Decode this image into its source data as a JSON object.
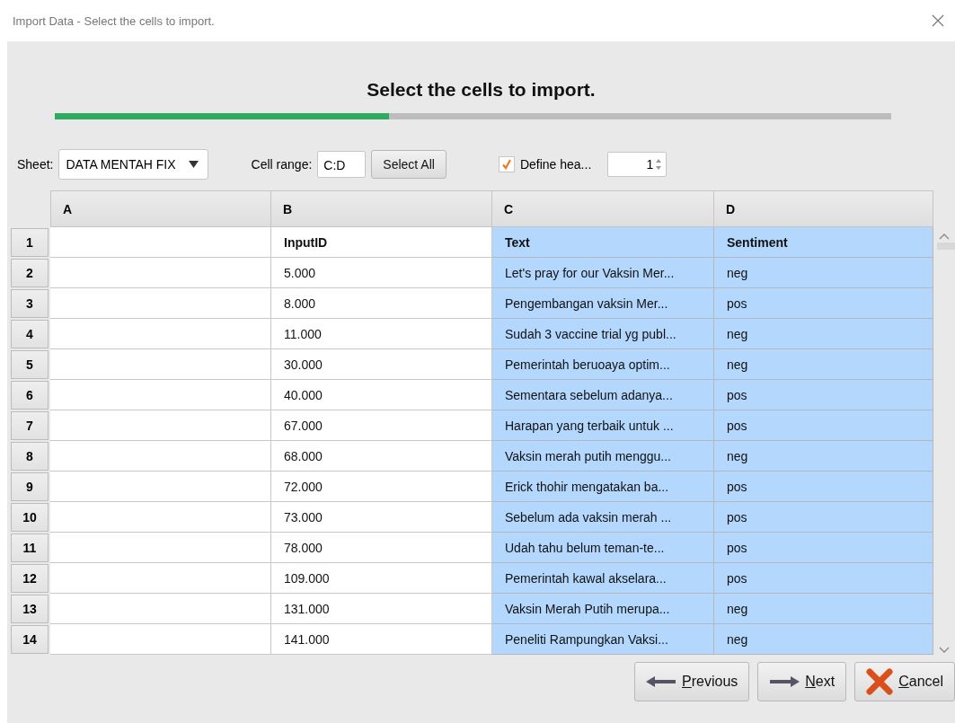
{
  "window": {
    "title": "Import Data - Select the cells to import."
  },
  "heading": "Select the cells to import.",
  "progress": {
    "level": 0.4
  },
  "toolbar": {
    "sheet_label": "Sheet:",
    "sheet_value": "DATA MENTAH FIX",
    "range_label": "Cell range:",
    "range_value": "C:D",
    "select_all": "Select All",
    "define_header": {
      "label": "Define hea...",
      "checked": true
    },
    "header_row": "1"
  },
  "table": {
    "columns": [
      {
        "label": "A",
        "selected": false
      },
      {
        "label": "B",
        "selected": false
      },
      {
        "label": "C",
        "selected": true
      },
      {
        "label": "D",
        "selected": true
      }
    ],
    "rows": [
      {
        "number": "1",
        "kind": "header",
        "cells": [
          "",
          "InputID",
          "Text",
          "Sentiment"
        ]
      },
      {
        "number": "2",
        "kind": "data",
        "cells": [
          "",
          "5.000",
          "Let's pray for our Vaksin Mer...",
          "neg"
        ]
      },
      {
        "number": "3",
        "kind": "data",
        "cells": [
          "",
          "8.000",
          "Pengembangan vaksin Mer...",
          "pos"
        ]
      },
      {
        "number": "4",
        "kind": "data",
        "cells": [
          "",
          "11.000",
          "Sudah 3 vaccine trial yg publ...",
          "neg"
        ]
      },
      {
        "number": "5",
        "kind": "data",
        "cells": [
          "",
          "30.000",
          "Pemerintah beruoaya optim...",
          "neg"
        ]
      },
      {
        "number": "6",
        "kind": "data",
        "cells": [
          "",
          "40.000",
          "Sementara sebelum adanya...",
          "pos"
        ]
      },
      {
        "number": "7",
        "kind": "data",
        "cells": [
          "",
          "67.000",
          "Harapan yang terbaik untuk ...",
          "pos"
        ]
      },
      {
        "number": "8",
        "kind": "data",
        "cells": [
          "",
          "68.000",
          "Vaksin merah putih menggu...",
          "neg"
        ]
      },
      {
        "number": "9",
        "kind": "data",
        "cells": [
          "",
          "72.000",
          "Erick thohir mengatakan ba...",
          "pos"
        ]
      },
      {
        "number": "10",
        "kind": "data",
        "cells": [
          "",
          "73.000",
          "Sebelum ada vaksin merah ...",
          "pos"
        ]
      },
      {
        "number": "11",
        "kind": "data",
        "cells": [
          "",
          "78.000",
          "Udah tahu belum teman-te...",
          "pos"
        ]
      },
      {
        "number": "12",
        "kind": "data",
        "cells": [
          "",
          "109.000",
          "Pemerintah kawal akselara...",
          "pos"
        ]
      },
      {
        "number": "13",
        "kind": "data",
        "cells": [
          "",
          "131.000",
          "Vaksin Merah Putih merupa...",
          "neg"
        ]
      },
      {
        "number": "14",
        "kind": "data",
        "cells": [
          "",
          "141.000",
          "Peneliti Rampungkan Vaksi...",
          "neg"
        ]
      }
    ]
  },
  "buttons": [
    {
      "label": "Previous",
      "kind": "previous"
    },
    {
      "label": "Next",
      "kind": "next"
    },
    {
      "label": "Cancel",
      "kind": "cancel"
    }
  ]
}
